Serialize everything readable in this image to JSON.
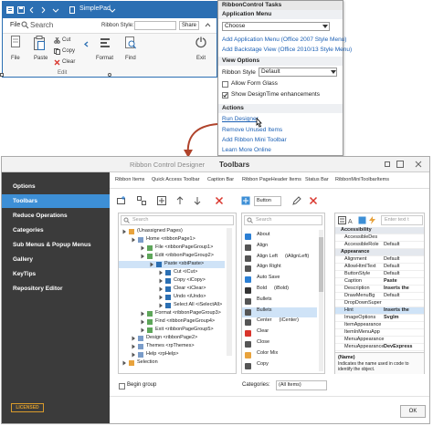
{
  "app": {
    "title": "SimplePad",
    "file_label": "File",
    "search_label": "Search",
    "ribbon_style_label": "Ribbon Style:",
    "share_label": "Share",
    "file_btn": "File",
    "paste_btn": "Paste",
    "cut_btn": "Cut",
    "copy_btn": "Copy",
    "clear_btn": "Clear",
    "edit_group": "Edit",
    "format_btn": "Format",
    "find_btn": "Find",
    "exit_btn": "Exit"
  },
  "tasks": {
    "header": "RibbonControl Tasks",
    "app_menu_header": "Application Menu",
    "choose_value": "Choose",
    "link_add_app_menu": "Add Application Menu (Office 2007 Style Menu)",
    "link_add_backstage": "Add Backstage View (Office 2010/13 Style Menu)",
    "view_options_header": "View Options",
    "ribbon_style_label": "Ribbon Style",
    "ribbon_style_value": "Default",
    "allow_form_glass": "Allow Form Glass",
    "show_designtime": "Show DesignTime enhancements",
    "show_designtime_checked": true,
    "actions_header": "Actions",
    "link_run_designer": "Run Designer",
    "link_remove_unused": "Remove Unused Items",
    "link_add_mini_toolbar": "Add Ribbon Mini Toolbar",
    "link_learn_more": "Learn More Online"
  },
  "designer": {
    "title_prefix": "Ribbon Control Designer",
    "title_page": "Toolbars",
    "nav": [
      "Options",
      "Toolbars",
      "Reduce Operations",
      "Categories",
      "Sub Menus & Popup Menus",
      "Gallery",
      "KeyTips",
      "Repository Editor"
    ],
    "nav_active": 1,
    "licensed": "LICENSED",
    "tabs": [
      "Ribbon Items",
      "Quick Access Toolbar",
      "Caption Bar",
      "Ribbon PageHeader Items",
      "Status Bar",
      "RibbonMiniToolbarItems"
    ],
    "button_dropdown": "Button",
    "search_placeholder": "Search",
    "tree": [
      {
        "text": "(Unassigned Pages)",
        "indent": 0,
        "highlight": false
      },
      {
        "text": "Home   <ribbonPage1>",
        "indent": 1,
        "highlight": false
      },
      {
        "text": "File   <ribbonPageGroup1>",
        "indent": 2,
        "highlight": false
      },
      {
        "text": "Edit   <ribbonPageGroup2>",
        "indent": 2,
        "highlight": false
      },
      {
        "text": "Paste   <sbiPaste>",
        "indent": 3,
        "highlight": true
      },
      {
        "text": "Cut   <iCut>",
        "indent": 4,
        "highlight": false
      },
      {
        "text": "Copy   <iCopy>",
        "indent": 4,
        "highlight": false
      },
      {
        "text": "Clear   <iClear>",
        "indent": 4,
        "highlight": false
      },
      {
        "text": "Undo   <iUndo>",
        "indent": 4,
        "highlight": false
      },
      {
        "text": "Select All   <iSelectAll>",
        "indent": 4,
        "highlight": false
      },
      {
        "text": "Format   <ribbonPageGroup3>",
        "indent": 2,
        "highlight": false
      },
      {
        "text": "Find   <ribbonPageGroup4>",
        "indent": 2,
        "highlight": false
      },
      {
        "text": "Exit   <ribbonPageGroup5>",
        "indent": 2,
        "highlight": false
      },
      {
        "text": "Design   <ribbonPage2>",
        "indent": 1,
        "highlight": false
      },
      {
        "text": "Themes   <rpThemes>",
        "indent": 1,
        "highlight": false
      },
      {
        "text": "Help   <rpHelp>",
        "indent": 1,
        "highlight": false
      },
      {
        "text": "Selection",
        "indent": 0,
        "highlight": false
      }
    ],
    "begin_group": "Begin group",
    "commands": [
      {
        "name": "About",
        "alias": "",
        "icon": "info-icon",
        "color": "#2b7fd4"
      },
      {
        "name": "Align",
        "alias": "",
        "icon": "align-icon",
        "color": "#555555"
      },
      {
        "name": "Align Left",
        "alias": "(iAlignLeft)",
        "icon": "align-left-icon",
        "color": "#555555"
      },
      {
        "name": "Align Right",
        "alias": "",
        "icon": "align-right-icon",
        "color": "#555555"
      },
      {
        "name": "Auto Save",
        "alias": "",
        "icon": "toggle-icon",
        "color": "#2b7fd4"
      },
      {
        "name": "Bold",
        "alias": "(iBold)",
        "icon": "bold-icon",
        "color": "#333333"
      },
      {
        "name": "Bullets",
        "alias": "",
        "icon": "bullets-icon",
        "color": "#555555"
      },
      {
        "name": "Bullets",
        "alias": "",
        "icon": "bullets-icon",
        "color": "#555555"
      },
      {
        "name": "Center",
        "alias": "(iCenter)",
        "icon": "center-icon",
        "color": "#555555"
      },
      {
        "name": "Clear",
        "alias": "",
        "icon": "clear-icon",
        "color": "#d9342b"
      },
      {
        "name": "Close",
        "alias": "",
        "icon": "close-icon",
        "color": "#555555"
      },
      {
        "name": "Color Mix",
        "alias": "",
        "icon": "color-mix-icon",
        "color": "#e8a33d"
      },
      {
        "name": "Copy",
        "alias": "",
        "icon": "copy-icon",
        "color": "#555555"
      }
    ],
    "commands_highlight": 7,
    "categories_label": "Categories:",
    "categories_value": "(All Items)",
    "props_search_placeholder": "Enter text t",
    "props": [
      {
        "type": "cat",
        "k": "Accessibility",
        "v": ""
      },
      {
        "type": "row",
        "k": "AccessibleDes",
        "v": ""
      },
      {
        "type": "row",
        "k": "AccessibleRole",
        "v": "Default"
      },
      {
        "type": "cat",
        "k": "Appearance",
        "v": ""
      },
      {
        "type": "row",
        "k": "Alignment",
        "v": "Default"
      },
      {
        "type": "row",
        "k": "AllowHtmlText",
        "v": "Default"
      },
      {
        "type": "row",
        "k": "ButtonStyle",
        "v": "Default"
      },
      {
        "type": "row",
        "k": "Caption",
        "v": "Paste"
      },
      {
        "type": "row",
        "k": "Description",
        "v": "Inserts the"
      },
      {
        "type": "row",
        "k": "DrawMenuBg",
        "v": "Default"
      },
      {
        "type": "row",
        "k": "DropDownSuper",
        "v": ""
      },
      {
        "type": "sel",
        "k": "Hint",
        "v": "Inserts the"
      },
      {
        "type": "row",
        "k": "ImageOptions",
        "v": "SvgIm"
      },
      {
        "type": "row",
        "k": "ItemAppearance",
        "v": ""
      },
      {
        "type": "row",
        "k": "ItemInMenuApp",
        "v": ""
      },
      {
        "type": "row",
        "k": "MenuAppearance",
        "v": ""
      },
      {
        "type": "row",
        "k": "MenuAppearance",
        "v": "DevExpress"
      }
    ],
    "name_header": "(Name)",
    "name_desc": "Indicates the name used in code to identify the object.",
    "ok_label": "OK"
  },
  "colors": {
    "accent": "#2b6fb3",
    "nav_bg": "#3b3b3b",
    "nav_active": "#3d8fd6",
    "link": "#1a5fb4",
    "arrow": "#b0432b"
  }
}
